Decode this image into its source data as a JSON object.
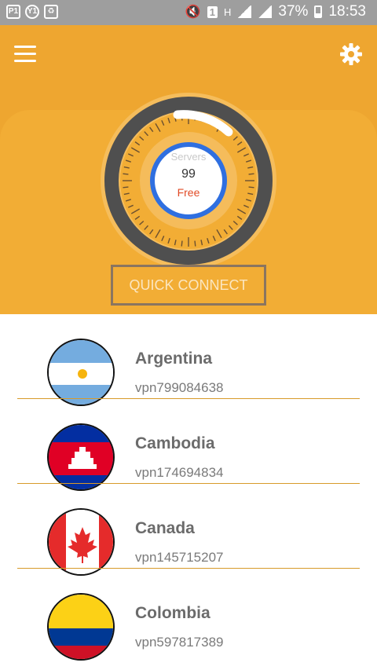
{
  "status_bar": {
    "left_icons": [
      "P1",
      "Y1",
      "recycle"
    ],
    "sim_label": "1",
    "network_label": "H",
    "battery_percent": "37%",
    "time": "18:53"
  },
  "toolbar": {
    "menu_icon": "hamburger-menu-icon",
    "settings_icon": "gear-icon"
  },
  "gauge": {
    "servers_label": "Servers",
    "servers_count": "99",
    "tier_label": "Free"
  },
  "quick_connect": {
    "label": "QUICK CONNECT"
  },
  "servers": [
    {
      "country": "Argentina",
      "server": "vpn799084638",
      "flag": "argentina"
    },
    {
      "country": "Cambodia",
      "server": "vpn174694834",
      "flag": "cambodia"
    },
    {
      "country": "Canada",
      "server": "vpn145715207",
      "flag": "canada"
    },
    {
      "country": "Colombia",
      "server": "vpn597817389",
      "flag": "colombia"
    }
  ],
  "colors": {
    "accent": "#eea630",
    "panel": "#f2ad35",
    "gauge_ring": "#2f6fe0",
    "free_text": "#e14b26",
    "status_bar": "#9e9e9e"
  }
}
